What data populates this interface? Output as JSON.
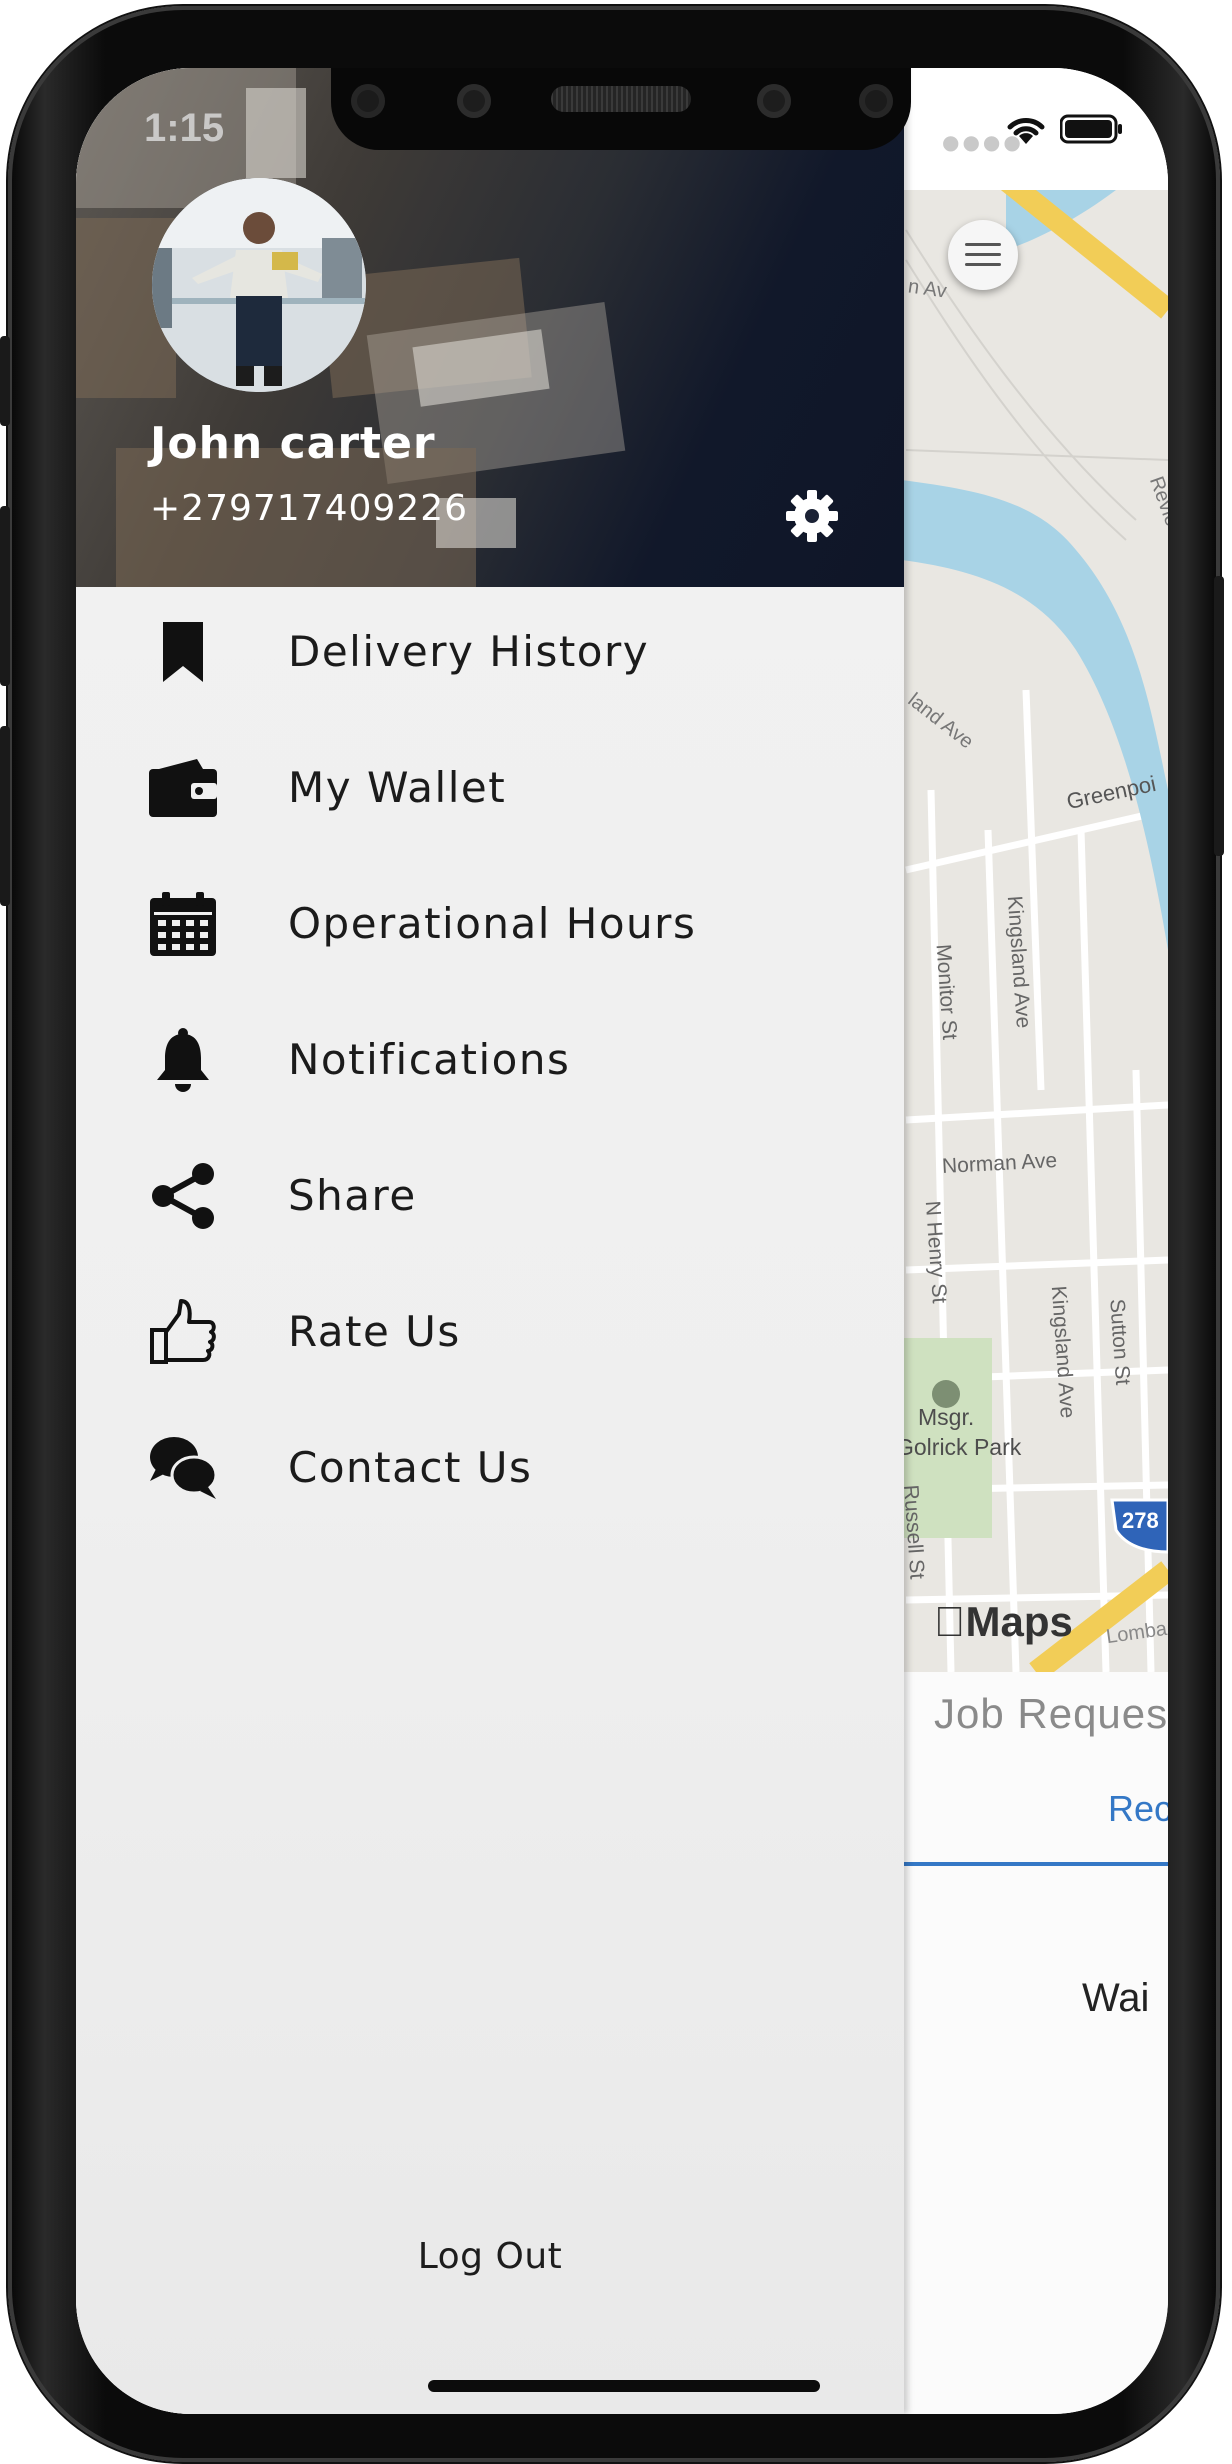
{
  "status_bar": {
    "time": "1:15"
  },
  "drawer": {
    "user": {
      "name": "John carter",
      "phone": "+279717409226"
    },
    "menu": [
      {
        "label": "Delivery History",
        "icon": "bookmark-icon"
      },
      {
        "label": "My Wallet",
        "icon": "wallet-icon"
      },
      {
        "label": "Operational Hours",
        "icon": "calendar-icon"
      },
      {
        "label": "Notifications",
        "icon": "bell-icon"
      },
      {
        "label": "Share",
        "icon": "share-icon"
      },
      {
        "label": "Rate Us",
        "icon": "thumbs-up-icon"
      },
      {
        "label": "Contact Us",
        "icon": "chat-bubbles-icon"
      }
    ],
    "logout_label": "Log Out"
  },
  "map": {
    "streets": {
      "monitor_st": "Monitor St",
      "kingsland_ave_1": "Kingsland Ave",
      "norman_ave": "Norman Ave",
      "n_henry_st": "N Henry St",
      "kingsland_ave_2": "Kingsland Ave",
      "sutton_st": "Sutton St",
      "greenpoint": "Greenpoi",
      "russell_st": "Russell St",
      "land_ave": "land Ave",
      "revie": "Revie",
      "an_av": "n Av",
      "lomba": "Lomba"
    },
    "park_label_line1": "Msgr.",
    "park_label_line2": "Golrick Park",
    "highway_shield": "278",
    "maps_brand": "Maps"
  },
  "app": {
    "job_title": "Job Reques",
    "tab_received": "Rec",
    "waiting_text": "Wai"
  },
  "colors": {
    "accent": "#3478c6",
    "water": "#a8d3e6",
    "highway": "#f2cd57",
    "park": "#cfe1c0",
    "map_bg": "#e9e7e2"
  }
}
